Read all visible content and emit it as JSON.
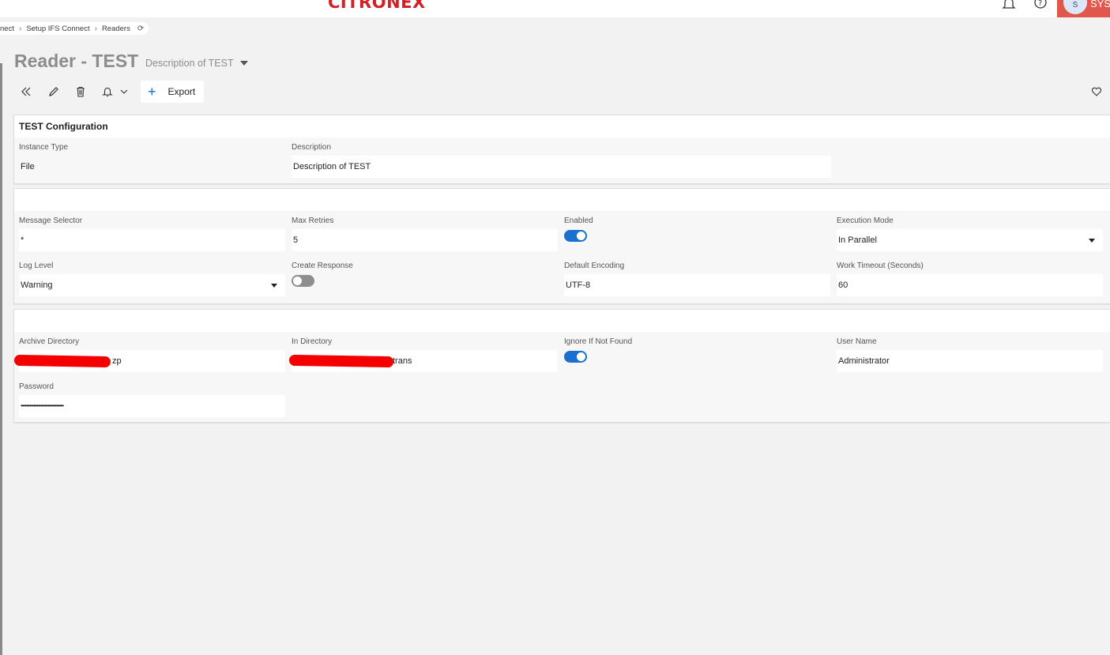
{
  "header": {
    "logo_text": "CITRONEX",
    "user_initial": "S",
    "user_name": "SYS",
    "accent_color": "#e2574c",
    "icons": [
      "bell-icon",
      "help-icon"
    ]
  },
  "breadcrumb": {
    "items": [
      "nect",
      "Setup IFS Connect",
      "Readers"
    ],
    "refresh_icon": "refresh-icon"
  },
  "page": {
    "title": "Reader - TEST",
    "subtitle": "Description of TEST"
  },
  "toolbar": {
    "export_label": "Export",
    "icons": [
      "double-chevron-left-icon",
      "pencil-icon",
      "trash-icon",
      "bell-icon",
      "chevron-down-icon",
      "plus-icon",
      "heart-icon"
    ]
  },
  "config_panel": {
    "title": "TEST Configuration",
    "instance_type_label": "Instance Type",
    "instance_type_value": "File",
    "description_label": "Description",
    "description_value": "Description of TEST"
  },
  "settings_panel": {
    "message_selector_label": "Message Selector",
    "message_selector_value": "*",
    "max_retries_label": "Max Retries",
    "max_retries_value": "5",
    "enabled_label": "Enabled",
    "enabled_value": true,
    "execution_mode_label": "Execution Mode",
    "execution_mode_value": "In Parallel",
    "log_level_label": "Log Level",
    "log_level_value": "Warning",
    "create_response_label": "Create Response",
    "create_response_value": false,
    "default_encoding_label": "Default Encoding",
    "default_encoding_value": "UTF-8",
    "work_timeout_label": "Work Timeout (Seconds)",
    "work_timeout_value": "60"
  },
  "file_panel": {
    "archive_directory_label": "Archive Directory",
    "archive_directory_value": "zp",
    "in_directory_label": "In Directory",
    "in_directory_value": "trans",
    "ignore_if_not_found_label": "Ignore If Not Found",
    "ignore_if_not_found_value": true,
    "user_name_label": "User Name",
    "user_name_value": "Administrator",
    "password_label": "Password",
    "password_value": "••••••••••••••••••••••••••••••"
  }
}
